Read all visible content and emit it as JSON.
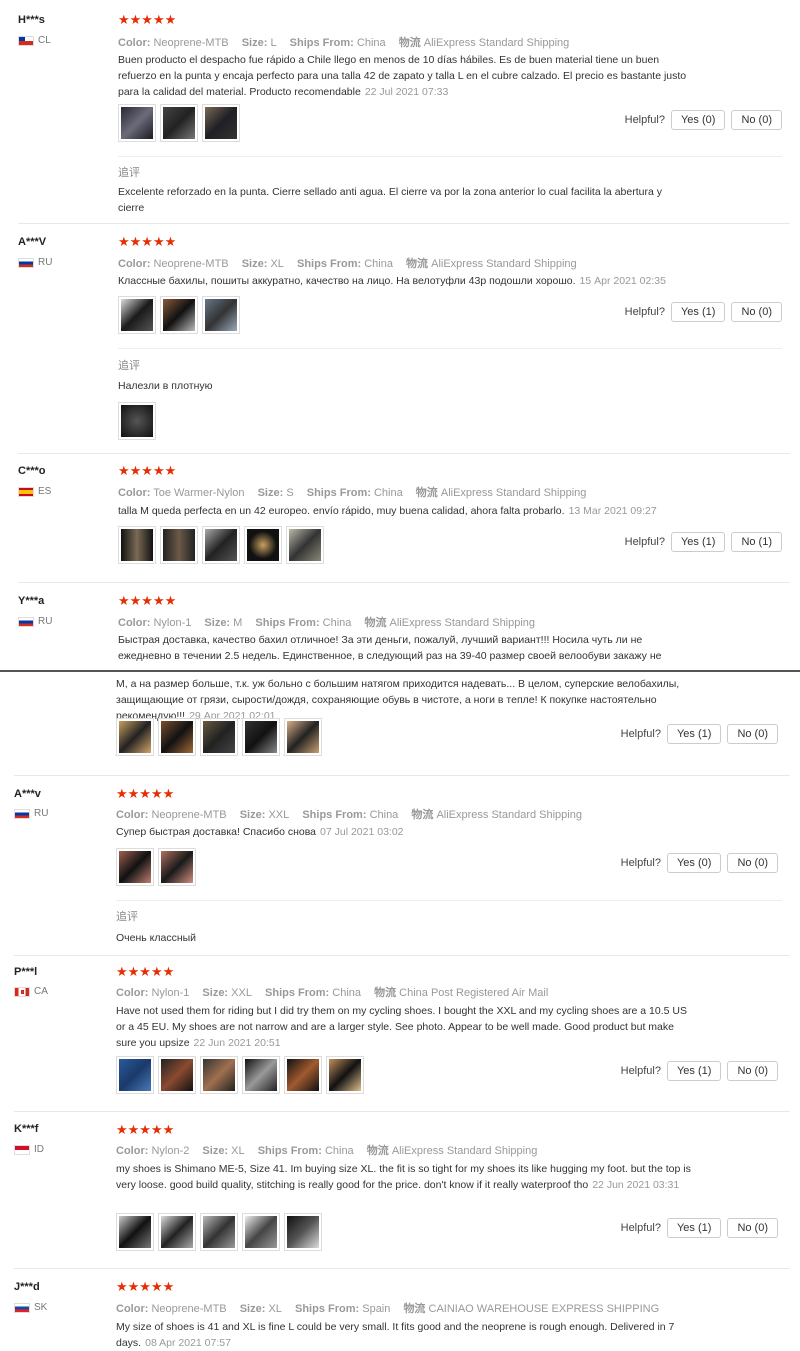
{
  "labels": {
    "color": "Color:",
    "size": "Size:",
    "ships_from": "Ships From:",
    "logistics": "物流",
    "helpful": "Helpful?",
    "followup": "追评",
    "stars": "★★★★★"
  },
  "reviews": [
    {
      "user": "H***s",
      "country": "CL",
      "color": "Neoprene-MTB",
      "size": "L",
      "ships_from": "China",
      "shipping": "AliExpress Standard Shipping",
      "text": "Buen producto el despacho fue rápido a Chile llego en menos de 10 días hábiles. Es de buen material tiene un buen refuerzo en la punta y encaja perfecto para una talla 42 de zapato y talla L en el cubre calzado. El precio es bastante justo para la calidad del material. Producto recomendable",
      "date": "22 Jul 2021 07:33",
      "yes": "Yes (0)",
      "no": "No (0)",
      "followup": "Excelente reforzado en la punta. Cierre sellado anti agua. El cierre va por la zona anterior lo cual facilita la abertura y cierre"
    },
    {
      "user": "A***V",
      "country": "RU",
      "color": "Neoprene-MTB",
      "size": "XL",
      "ships_from": "China",
      "shipping": "AliExpress Standard Shipping",
      "text": "Классные бахилы, пошиты аккуратно, качество на лицо. На велотуфли 43р подошли хорошо.",
      "date": "15 Apr 2021 02:35",
      "yes": "Yes (1)",
      "no": "No (0)",
      "followup": "Налезли в плотную"
    },
    {
      "user": "C***o",
      "country": "ES",
      "color": "Toe Warmer-Nylon",
      "size": "S",
      "ships_from": "China",
      "shipping": "AliExpress Standard Shipping",
      "text": "talla M queda perfecta en un 42 europeo. envío rápido, muy buena calidad, ahora falta probarlo.",
      "date": "13 Mar 2021 09:27",
      "yes": "Yes (1)",
      "no": "No (1)"
    },
    {
      "user": "Y***a",
      "country": "RU",
      "color": "Nylon-1",
      "size": "M",
      "ships_from": "China",
      "shipping": "AliExpress Standard Shipping",
      "text_a": "Быстрая доставка, качество бахил отличное! За эти деньги, пожалуй, лучший вариант!!! Носила чуть ли не ежедневно в течении 2.5 недель. Единственное, в следующий раз на 39-40 размер своей велообуви закажу не",
      "text_b": "М, а на размер больше, т.к. уж больно с большим натягом приходится надевать... В целом, суперские велобахилы, защищающие от грязи, сырости/дождя, сохраняющие обувь в чистоте, а ноги в тепле! К покупке настоятельно рекомендую!!!",
      "date": "29 Apr 2021 02:01",
      "yes": "Yes (1)",
      "no": "No (0)"
    },
    {
      "user": "A***v",
      "country": "RU",
      "color": "Neoprene-MTB",
      "size": "XXL",
      "ships_from": "China",
      "shipping": "AliExpress Standard Shipping",
      "text": "Супер быстрая доставка! Спасибо снова",
      "date": "07 Jul 2021 03:02",
      "yes": "Yes (0)",
      "no": "No (0)",
      "followup": "Очень классный"
    },
    {
      "user": "P***l",
      "country": "CA",
      "color": "Nylon-1",
      "size": "XXL",
      "ships_from": "China",
      "shipping": "China Post Registered Air Mail",
      "text": "Have not used them for riding but I did try them on my cycling shoes. I bought the XXL and my cycling shoes are a 10.5 US or a 45 EU. My shoes are not narrow and are a larger style. See photo. Appear to be well made. Good product but make sure you upsize",
      "date": "22 Jun 2021 20:51",
      "yes": "Yes (1)",
      "no": "No (0)"
    },
    {
      "user": "K***f",
      "country": "ID",
      "color": "Nylon-2",
      "size": "XL",
      "ships_from": "China",
      "shipping": "AliExpress Standard Shipping",
      "text": "my shoes is Shimano ME-5, Size 41. Im buying size XL. the fit is so tight for my shoes its like hugging my foot. but the top is very loose. good build quality, stitching is really good for the price. don't know if it really waterproof tho",
      "date": "22 Jun 2021 03:31",
      "yes": "Yes (1)",
      "no": "No (0)"
    },
    {
      "user": "J***d",
      "country": "SK",
      "color": "Neoprene-MTB",
      "size": "XL",
      "ships_from": "Spain",
      "shipping": "CAINIAO WAREHOUSE EXPRESS SHIPPING",
      "text": "My size of shoes is 41 and XL is fine L could be very small. It fits good and the neoprene is rough enough. Delivered in 7 days.",
      "date": "08 Apr 2021 07:57"
    }
  ],
  "colors": {
    "star": "#e62e04",
    "meta": "#999999",
    "text": "#333333"
  }
}
